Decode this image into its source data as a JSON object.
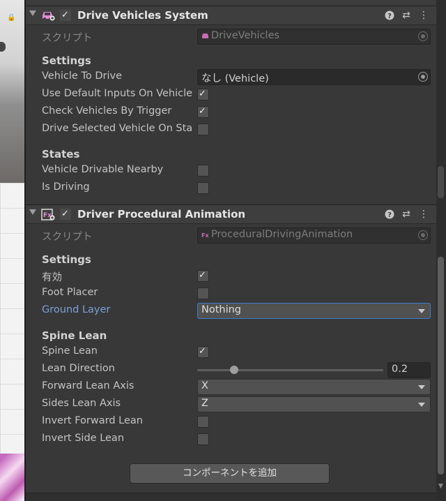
{
  "components": [
    {
      "title": "Drive Vehicles System",
      "enabled": true,
      "script_label": "スクリプト",
      "script_value": "DriveVehicles",
      "settings_header": "Settings",
      "vehicle_to_drive_label": "Vehicle To Drive",
      "vehicle_to_drive_value": "なし (Vehicle)",
      "use_default_inputs_label": "Use Default Inputs On Vehicle",
      "use_default_inputs": true,
      "check_by_trigger_label": "Check Vehicles By Trigger",
      "check_by_trigger": true,
      "drive_selected_label": "Drive Selected Vehicle On Sta",
      "drive_selected": false,
      "states_header": "States",
      "drivable_nearby_label": "Vehicle Drivable Nearby",
      "drivable_nearby": false,
      "is_driving_label": "Is Driving",
      "is_driving": false
    },
    {
      "title": "Driver Procedural Animation",
      "enabled": true,
      "script_label": "スクリプト",
      "script_value": "ProceduralDrivingAnimation",
      "settings_header": "Settings",
      "enabled_label": "有効",
      "enabled_field": true,
      "foot_placer_label": "Foot Placer",
      "foot_placer": false,
      "ground_layer_label": "Ground Layer",
      "ground_layer_value": "Nothing",
      "spine_lean_header": "Spine Lean",
      "spine_lean_label": "Spine Lean",
      "spine_lean": true,
      "lean_direction_label": "Lean Direction",
      "lean_direction_value": "0.2",
      "lean_direction_fraction": 0.2,
      "forward_axis_label": "Forward Lean Axis",
      "forward_axis_value": "X",
      "sides_axis_label": "Sides Lean Axis",
      "sides_axis_value": "Z",
      "invert_forward_label": "Invert Forward Lean",
      "invert_forward": false,
      "invert_side_label": "Invert Side Lean",
      "invert_side": false
    }
  ],
  "add_component_label": "コンポーネントを追加",
  "colors": {
    "background": "#383838",
    "header": "#3e3e3e",
    "accent_blue": "#7ca1d7",
    "focus_border": "#3d7ccf",
    "vehicle_icon": "#e58ad6"
  }
}
